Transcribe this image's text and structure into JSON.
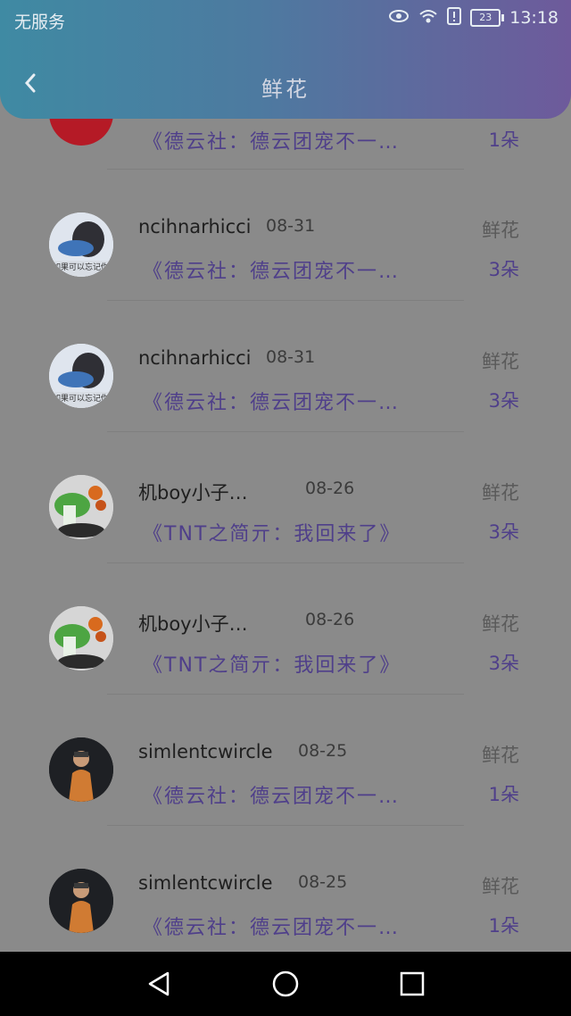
{
  "status_bar": {
    "carrier": "无服务",
    "battery": "23",
    "time": "13:18"
  },
  "header": {
    "title": "鲜花",
    "back_icon": "chevron-left-icon"
  },
  "list": [
    {
      "name": "",
      "date": "",
      "type": "",
      "title": "《德云社：德云团宠不一…",
      "count": "1朵",
      "avatar": "red-avatar"
    },
    {
      "name": "ncihnarhicci",
      "date": "08-31",
      "type": "鲜花",
      "title": "《德云社：德云团宠不一…",
      "count": "3朵",
      "avatar": "photo-avatar",
      "avatar_caption": "如果可以忘记你"
    },
    {
      "name": "ncihnarhicci",
      "date": "08-31",
      "type": "鲜花",
      "title": "《德云社：德云团宠不一…",
      "count": "3朵",
      "avatar": "photo-avatar",
      "avatar_caption": "如果可以忘记你"
    },
    {
      "name": "机boy小子…",
      "date": "08-26",
      "type": "鲜花",
      "title": "《TNT之简亓：我回来了》",
      "count": "3朵",
      "avatar": "cabbage-avatar"
    },
    {
      "name": "机boy小子…",
      "date": "08-26",
      "type": "鲜花",
      "title": "《TNT之简亓：我回来了》",
      "count": "3朵",
      "avatar": "cabbage-avatar"
    },
    {
      "name": "simlentcwircle",
      "date": "08-25",
      "type": "鲜花",
      "title": "《德云社：德云团宠不一…",
      "count": "1朵",
      "avatar": "character-avatar"
    },
    {
      "name": "simlentcwircle",
      "date": "08-25",
      "type": "鲜花",
      "title": "《德云社：德云团宠不一…",
      "count": "1朵",
      "avatar": "character-avatar"
    }
  ],
  "system_nav": {
    "back": "back-triangle-icon",
    "home": "home-circle-icon",
    "recent": "recent-square-icon"
  }
}
